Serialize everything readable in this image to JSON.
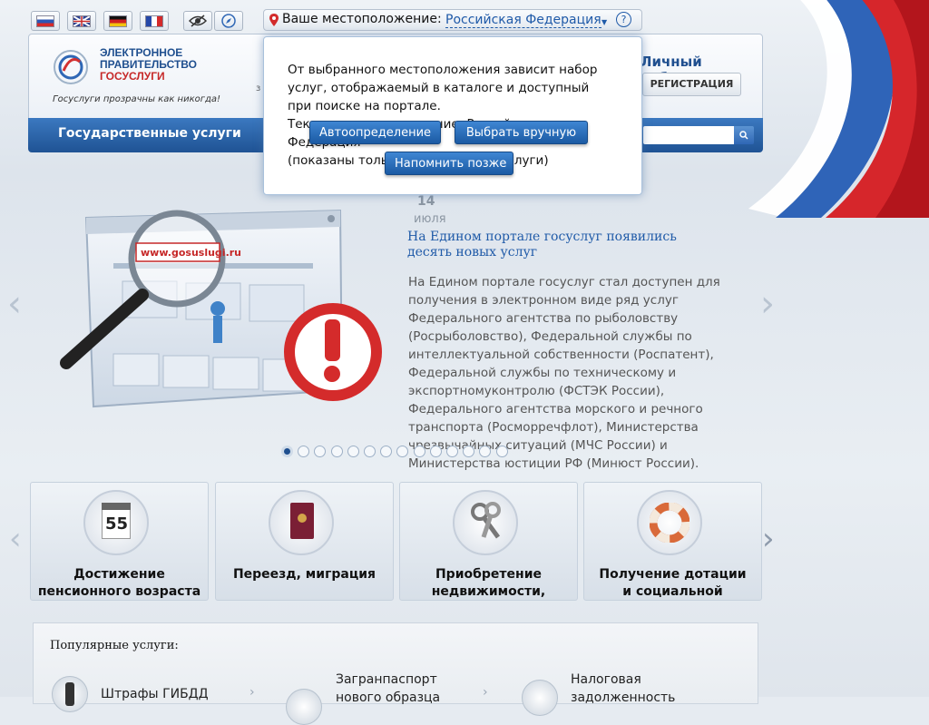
{
  "lang": {
    "flags": [
      "Русский",
      "English",
      "Deutsch",
      "Français"
    ],
    "icons": [
      "eye-icon",
      "compass-icon"
    ]
  },
  "location": {
    "label": "Ваше местоположение:",
    "value": "Российская Федерация",
    "help": "?"
  },
  "logo": {
    "line1": "ЭЛЕКТРОННОЕ",
    "line2": "ПРАВИТЕЛЬСТВО",
    "line3": "ГОСУСЛУГИ",
    "slogan": "Госуслуги прозрачны как никогда!"
  },
  "cabinet": {
    "title": "Личный кабинет:",
    "register": "РЕГИСТРАЦИЯ"
  },
  "nav": {
    "services": "Государственные услуги"
  },
  "popup": {
    "text_line1": "От выбранного местоположения зависит набор",
    "text_line2": "услуг, отображаемый в каталоге и доступный",
    "text_line3": "при поиске на портале.",
    "text_line4": "Текущее местоположение: Российская",
    "text_line5": "Федерация",
    "text_line6": "(показаны только федеральные услуги)",
    "btn_auto": "Автоопределение",
    "btn_manual": "Выбрать вручную",
    "btn_later": "Напомнить позже"
  },
  "news": {
    "day": "14",
    "month": "июля",
    "title_line1": "На Едином портале госуслуг появились",
    "title_line2": "десять новых услуг",
    "body": [
      "На Едином портале госуслуг стал доступен для",
      "получения в электронном виде ряд услуг",
      "Федерального агентства по рыболовству",
      "(Росрыболовство), Федеральной службы по",
      "интеллектуальной собственности (Роспатент),",
      "Федеральной службы по техническому и",
      "экспортномуконтролю (ФСТЭК России),",
      "Федерального агентства морского и речного",
      "транспорта (Росморречфлот), Министерства",
      "чрезвычайных ситуаций (МЧС России) и",
      "Министерства юстиции РФ (Минюст России)."
    ],
    "illustration_url": "www.gosuslugi.ru",
    "dots_total": 14,
    "dots_active": 0
  },
  "categories": [
    {
      "line1": "Достижение",
      "line2": "пенсионного возраста",
      "icon": "calendar-icon",
      "icon_text": "55"
    },
    {
      "line1": "Переезд, миграция",
      "line2": "",
      "icon": "passport-icon"
    },
    {
      "line1": "Приобретение",
      "line2": "недвижимости,",
      "icon": "keys-icon"
    },
    {
      "line1": "Получение дотации",
      "line2": "и социальной",
      "icon": "lifebuoy-icon"
    }
  ],
  "popular": {
    "title": "Популярные услуги:",
    "items": [
      {
        "line1": "Штрафы ГИБДД",
        "line2": "",
        "icon": "traffic-light-icon"
      },
      {
        "line1": "Загранпаспорт",
        "line2": "нового образца",
        "icon": "passport-small-icon"
      },
      {
        "line1": "Налоговая",
        "line2": "задолженность",
        "icon": "tax-icon"
      }
    ]
  }
}
